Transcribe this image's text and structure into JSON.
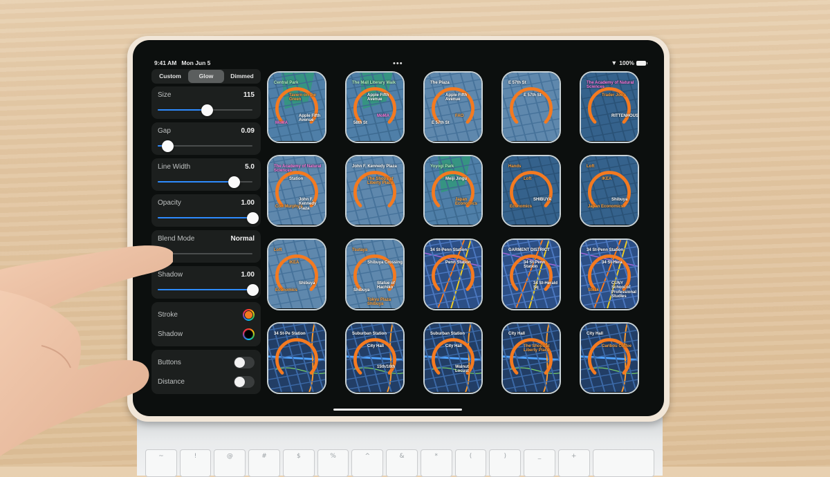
{
  "status_bar": {
    "time": "9:41 AM",
    "date": "Mon Jun 5",
    "battery": "100%",
    "more_menu": "•••"
  },
  "sidebar": {
    "segments": [
      {
        "label": "Custom",
        "selected": false
      },
      {
        "label": "Glow",
        "selected": true
      },
      {
        "label": "Dimmed",
        "selected": false
      }
    ],
    "sliders": [
      {
        "label": "Size",
        "value": "115",
        "fraction": 0.52
      },
      {
        "label": "Gap",
        "value": "0.09",
        "fraction": 0.1
      },
      {
        "label": "Line Width",
        "value": "5.0",
        "fraction": 0.8
      },
      {
        "label": "Opacity",
        "value": "1.00",
        "fraction": 1.0
      },
      {
        "label": "Blend Mode",
        "value": "Normal",
        "fraction": 0.0
      },
      {
        "label": "Shadow",
        "value": "1.00",
        "fraction": 1.0
      }
    ],
    "colors": [
      {
        "label": "Stroke",
        "color": "#f47a20"
      },
      {
        "label": "Shadow",
        "color": "#000000"
      }
    ],
    "toggles": [
      {
        "label": "Buttons",
        "on": false
      },
      {
        "label": "Distance",
        "on": false
      }
    ]
  },
  "accent": {
    "slider_fill": "#2e8bff",
    "ring": "#f47a20"
  },
  "tiles": [
    {
      "theme": "park",
      "labels": [
        {
          "t": "Central Park",
          "c": "g"
        },
        {
          "t": "Tavern on the Green",
          "c": "o"
        },
        {
          "t": "Apple Fifth Avenue",
          "c": ""
        },
        {
          "t": "MoMA",
          "c": "p"
        }
      ]
    },
    {
      "theme": "park",
      "labels": [
        {
          "t": "The Mall Literary Walk",
          "c": "g"
        },
        {
          "t": "Apple Fifth Avenue",
          "c": ""
        },
        {
          "t": "MoMA",
          "c": "p"
        },
        {
          "t": "58th St",
          "c": ""
        }
      ]
    },
    {
      "theme": "grid",
      "labels": [
        {
          "t": "The Plaza",
          "c": ""
        },
        {
          "t": "Apple Fifth Avenue",
          "c": ""
        },
        {
          "t": "FAO",
          "c": "o"
        },
        {
          "t": "E 57th St",
          "c": ""
        }
      ]
    },
    {
      "theme": "grid",
      "labels": [
        {
          "t": "E 57th St",
          "c": ""
        },
        {
          "t": "E 57th St",
          "c": ""
        }
      ]
    },
    {
      "theme": "dark",
      "labels": [
        {
          "t": "The Academy of Natural Sciences",
          "c": "p"
        },
        {
          "t": "Trader Joe's",
          "c": "o"
        },
        {
          "t": "RITTENHOUSE",
          "c": ""
        }
      ]
    },
    {
      "theme": "grid",
      "labels": [
        {
          "t": "The Academy of Natural Sciences",
          "c": "p"
        },
        {
          "t": "Station",
          "c": ""
        },
        {
          "t": "John F. Kennedy Plaza",
          "c": ""
        },
        {
          "t": "Con Murphy's",
          "c": "o"
        }
      ]
    },
    {
      "theme": "grid",
      "labels": [
        {
          "t": "John F. Kennedy Plaza",
          "c": ""
        },
        {
          "t": "The Shops at Liberty Place",
          "c": "o"
        }
      ]
    },
    {
      "theme": "park",
      "labels": [
        {
          "t": "Yoyogi Park",
          "c": "g"
        },
        {
          "t": "Meiji Jingu",
          "c": ""
        },
        {
          "t": "Japan Economics",
          "c": "o"
        }
      ]
    },
    {
      "theme": "dark",
      "labels": [
        {
          "t": "Hands",
          "c": "o"
        },
        {
          "t": "Loft",
          "c": "o"
        },
        {
          "t": "SHIBUYA",
          "c": ""
        },
        {
          "t": "Economics",
          "c": "o"
        }
      ]
    },
    {
      "theme": "dark",
      "labels": [
        {
          "t": "Loft",
          "c": "o"
        },
        {
          "t": "IKEA",
          "c": "o"
        },
        {
          "t": "Shibuya",
          "c": ""
        },
        {
          "t": "Japan Economics",
          "c": "o"
        }
      ]
    },
    {
      "theme": "grid",
      "labels": [
        {
          "t": "Loft",
          "c": "o"
        },
        {
          "t": "IKEA",
          "c": "o"
        },
        {
          "t": "Shibuya",
          "c": ""
        },
        {
          "t": "Economics",
          "c": "o"
        }
      ]
    },
    {
      "theme": "grid",
      "labels": [
        {
          "t": "Tsutaya",
          "c": "o"
        },
        {
          "t": "Shibuya Crossing",
          "c": ""
        },
        {
          "t": "Statue of Hachiko",
          "c": ""
        },
        {
          "t": "Shibuya",
          "c": ""
        },
        {
          "t": "Tokyu Plaza Shibuya",
          "c": "o"
        }
      ]
    },
    {
      "theme": "transit",
      "labels": [
        {
          "t": "34 St-Penn Station",
          "c": ""
        },
        {
          "t": "Penn Station",
          "c": ""
        }
      ]
    },
    {
      "theme": "transit",
      "labels": [
        {
          "t": "GARMENT DISTRICT",
          "c": ""
        },
        {
          "t": "34 St-Penn Station",
          "c": ""
        },
        {
          "t": "34 St-Herald Sq",
          "c": ""
        }
      ]
    },
    {
      "theme": "transit",
      "labels": [
        {
          "t": "34 St-Penn Station",
          "c": ""
        },
        {
          "t": "34 St-Hera",
          "c": ""
        },
        {
          "t": "CUNY School of Professional Studies",
          "c": ""
        },
        {
          "t": "Steak",
          "c": "o"
        }
      ]
    },
    {
      "theme": "transit2",
      "labels": [
        {
          "t": "34 St-Pe Station",
          "c": ""
        }
      ]
    },
    {
      "theme": "transit2",
      "labels": [
        {
          "t": "Suburban Station",
          "c": ""
        },
        {
          "t": "City Hall",
          "c": ""
        },
        {
          "t": "15th/16th",
          "c": ""
        }
      ]
    },
    {
      "theme": "transit2",
      "labels": [
        {
          "t": "Suburban Station",
          "c": ""
        },
        {
          "t": "City Hall",
          "c": ""
        },
        {
          "t": "Walnut Locust",
          "c": ""
        }
      ]
    },
    {
      "theme": "transit2",
      "labels": [
        {
          "t": "City Hall",
          "c": ""
        },
        {
          "t": "The Shops at Liberty Place",
          "c": "o"
        }
      ]
    },
    {
      "theme": "transit2",
      "labels": [
        {
          "t": "City Hall",
          "c": ""
        },
        {
          "t": "Caribou Coffee",
          "c": "o"
        }
      ]
    }
  ],
  "keyboard": {
    "keys": [
      "~",
      "!",
      "@",
      "#",
      "$",
      "%",
      "^",
      "&",
      "*",
      "(",
      ")",
      "_",
      "+",
      ""
    ]
  }
}
